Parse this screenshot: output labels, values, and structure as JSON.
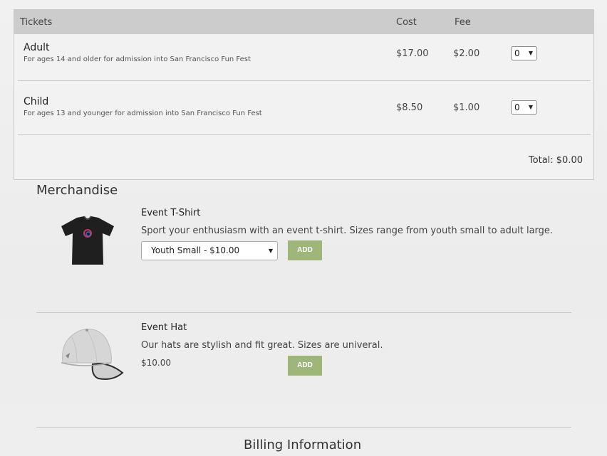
{
  "tickets": {
    "header": {
      "tickets": "Tickets",
      "cost": "Cost",
      "fee": "Fee"
    },
    "items": [
      {
        "name": "Adult",
        "description": "For ages 14 and older for admission into San Francisco Fun Fest",
        "cost": "$17.00",
        "fee": "$2.00",
        "quantity": "0"
      },
      {
        "name": "Child",
        "description": "For ages 13 and younger for admission into San Francisco Fun Fest",
        "cost": "$8.50",
        "fee": "$1.00",
        "quantity": "0"
      }
    ],
    "total": "Total: $0.00"
  },
  "merchandise": {
    "title": "Merchandise",
    "items": [
      {
        "name": "Event T-Shirt",
        "description": "Sport your enthusiasm with an event t-shirt. Sizes range from youth small to adult large.",
        "selected_option": "Youth Small - $10.00",
        "add_label": "ADD"
      },
      {
        "name": "Event Hat",
        "description": "Our hats are stylish and fit great. Sizes are univeral.",
        "price": "$10.00",
        "add_label": "ADD"
      }
    ]
  },
  "billing": {
    "title": "Billing Information"
  },
  "colors": {
    "header_bg": "#cccccc",
    "button_green": "#9fb67a"
  },
  "icons": {
    "select_arrow": "dropdown-arrow-icon"
  }
}
